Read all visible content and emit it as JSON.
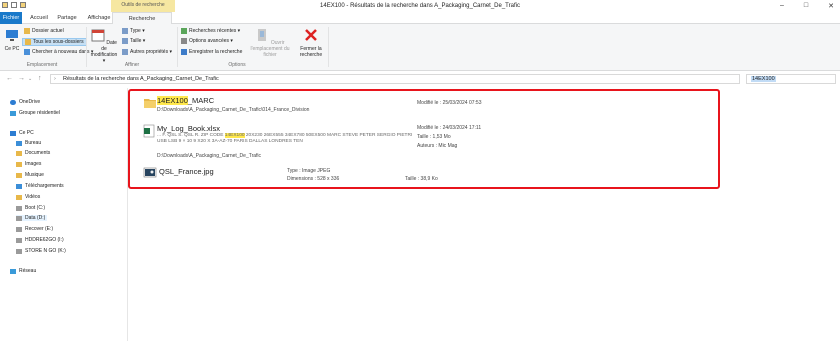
{
  "window": {
    "title": "14EX100 - Résultats de la recherche dans A_Packaging_Carnet_De_Trafic",
    "context_tab_label": "Outils de recherche",
    "controls": [
      "–",
      "□",
      "✕"
    ]
  },
  "tabs": [
    "Fichier",
    "Accueil",
    "Partage",
    "Affichage",
    "Recherche"
  ],
  "ribbon": {
    "this_pc": "Ce PC",
    "current_folder": "Dossier actuel",
    "all_subfolders": "Tous les sous-dossiers",
    "search_again": "Chercher à nouveau dans ▾",
    "group_location": "Emplacement",
    "modified_date": "Date de modification ▾",
    "type": "Type ▾",
    "size": "Taille ▾",
    "other_props": "Autres propriétés ▾",
    "group_refine": "Affiner",
    "recent_searches": "Recherches récentes ▾",
    "advanced_options": "Options avancées ▾",
    "save_search": "Enregistrer la recherche",
    "open_location": "Ouvrir l'emplacement du fichier",
    "close_search": "Fermer la recherche",
    "group_options": "Options"
  },
  "address": {
    "path": "Résultats de la recherche dans A_Packaging_Carnet_De_Trafic",
    "search_query": "14EX100"
  },
  "nav": {
    "items": [
      "OneDrive",
      "Groupe résidentiel",
      "Ce PC",
      "Bureau",
      "Documents",
      "Images",
      "Musique",
      "Téléchargements",
      "Vidéos",
      "Boot (C:)",
      "Data (D:)",
      "Recover (E:)",
      "HDDRE62GO (I:)",
      "STORE N GO (K:)",
      "Réseau"
    ]
  },
  "results": [
    {
      "name_hl": "14EX100",
      "name_rest": "_MARC",
      "path": "D:\\Downloads\\A_Packaging_Carnet_De_Trafic\\014_France_Division",
      "meta1": "Modifié le : 25/03/2024 07:53"
    },
    {
      "name": "My_Log_Book.xlsx",
      "excerpt_pre": "... F. QSL S. QSL R. ZIP CODE ",
      "excerpt_hl": "14EX100",
      "excerpt_post": " 20X230 26EX555 34EX780 50EX500 MARC STEVE PETER SERGIO PIETRI USB LSB 9 × 10 9 X20 X 3A-AZ-70 PARIS DALLAS LONDRES TEN",
      "path": "D:\\Downloads\\A_Packaging_Carnet_De_Trafic",
      "meta1": "Modifié le : 24/03/2024 17:11",
      "meta2": "Taille : 1,53 Mo",
      "meta3": "Auteurs : Mic Mag"
    },
    {
      "name": "QSL_France.jpg",
      "type": "Type : Image JPEG",
      "dims": "Dimensions : 528 x 336",
      "size": "Taille : 38,9 Ko"
    }
  ],
  "colors": {
    "file_tab": "#1979ca",
    "highlight": "#ffe84d",
    "red_box": "#e8141c",
    "context_tab": "#f6e7a1"
  }
}
